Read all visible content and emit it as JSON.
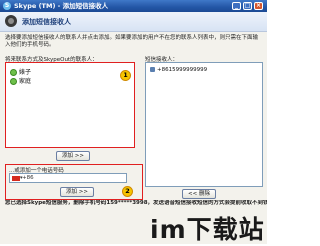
{
  "window": {
    "title": "Skype (TM) - 添加短信接收人",
    "buttons": {
      "minimize": "_",
      "maximize": "□",
      "close": "×"
    }
  },
  "header": {
    "title": "添加短信接收人",
    "icon": "skype-contact-icon"
  },
  "instructions": "选择要添加短信接收人的联系人并点击添加。如果要添加的用户不在您的联系人列表中，则只需在下面输入他们的手机号码。",
  "contacts_panel": {
    "label": "将来联系方式及SkypeOut的联系人：",
    "items": [
      {
        "name": "婊子",
        "status": "online"
      },
      {
        "name": "家庭",
        "status": "online"
      }
    ],
    "badge": "1",
    "add_button": "添加 >>"
  },
  "recipients_panel": {
    "label": "短信接收人：",
    "items": [
      "+8615999999999"
    ],
    "remove_button": "<< 删除"
  },
  "phone_panel": {
    "label": "...或添加一个电话号码",
    "placeholder": "",
    "value": "+86",
    "badge": "2",
    "add_button": "添加 >>"
  },
  "note": "您已选择Skype短信服务，删除手机号码159*****3998，发送语音短信接收短信的方式会提前收取不到钱。",
  "watermark": {
    "main": "im下载站",
    "dot": ""
  },
  "colors": {
    "titlebar": "#2356a6",
    "badge": "#f6c400",
    "highlight_frame": "#e02020"
  }
}
